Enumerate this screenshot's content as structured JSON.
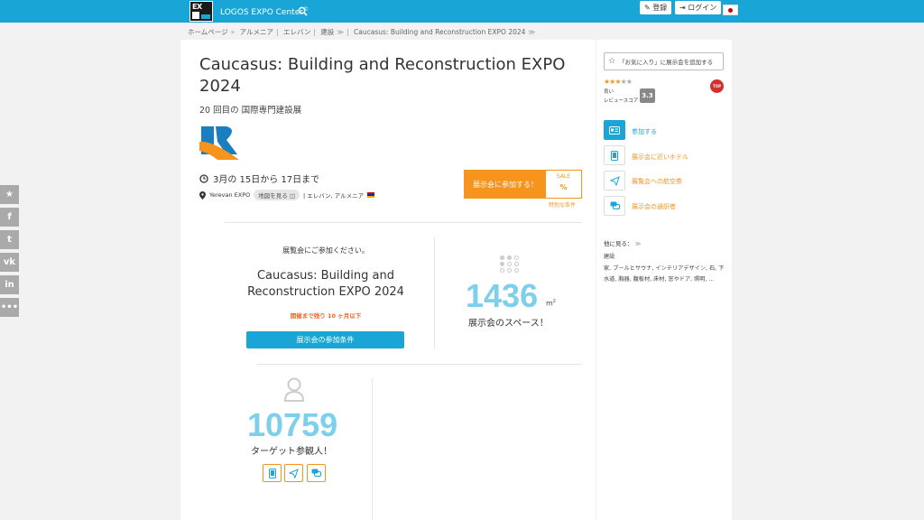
{
  "topbar": {
    "brand": "LOGOS EXPO Center",
    "brand_mark": "©",
    "register_label": "登録",
    "login_label": "ログイン"
  },
  "breadcrumb": {
    "items": [
      "ホームページ",
      "アルメニア",
      "エレバン",
      "建設",
      "Caucasus: Building and Reconstruction EXPO 2024"
    ]
  },
  "event": {
    "title": "Caucasus: Building and Reconstruction EXPO 2024",
    "subtitle": "20 回目の 国際専門建設展",
    "dates": "3月の 15日から 17日まで",
    "venue": "Yerevan EXPO",
    "map_button": "地図を見る",
    "location": "| エレバン, アルメニア"
  },
  "cta": {
    "label": "展示会に参加する！",
    "sale": "SALE",
    "percent": "%",
    "special": "特別な条件"
  },
  "invite": {
    "text": "展覧会にご参加ください。",
    "title": "Caucasus: Building and Reconstruction EXPO 2024",
    "countdown": "開催まで残り 10 ヶ月以下",
    "conditions_button": "展示会の参加条件"
  },
  "stats": {
    "space_value": "1436",
    "space_unit": "m",
    "space_unit_sup": "2",
    "space_label": "展示会のスペース！",
    "visitors_value": "10759",
    "visitors_label": "ターゲット参観人！"
  },
  "sidebar": {
    "favorite": "「お気に入り」に展示会を追加する",
    "rating_word": "良い",
    "review_label": "レビュースコア",
    "score": "3.3",
    "stars_on": 3,
    "stars_total": 5,
    "badge": "TOP",
    "actions": [
      {
        "label": "参加する",
        "icon": "id-card-icon",
        "color": "#19a6d6"
      },
      {
        "label": "展示会に近いホテル",
        "icon": "phone-icon",
        "color": "#f7941d"
      },
      {
        "label": "展覧会への航空券",
        "icon": "plane-icon",
        "color": "#f7941d"
      },
      {
        "label": "展示会の通訳者",
        "icon": "chat-icon",
        "color": "#f7941d"
      }
    ],
    "see_also": "他に見る：",
    "tags_heading": "建設",
    "tags": "家, プールとサウナ, インテリアデザイン, 石, 下水道, 胸器, 腹板材, 床材, 窓やドア, 照明, ..."
  },
  "colors": {
    "accent": "#19a6d6",
    "orange": "#f7941d",
    "number": "#7dd0ec"
  }
}
